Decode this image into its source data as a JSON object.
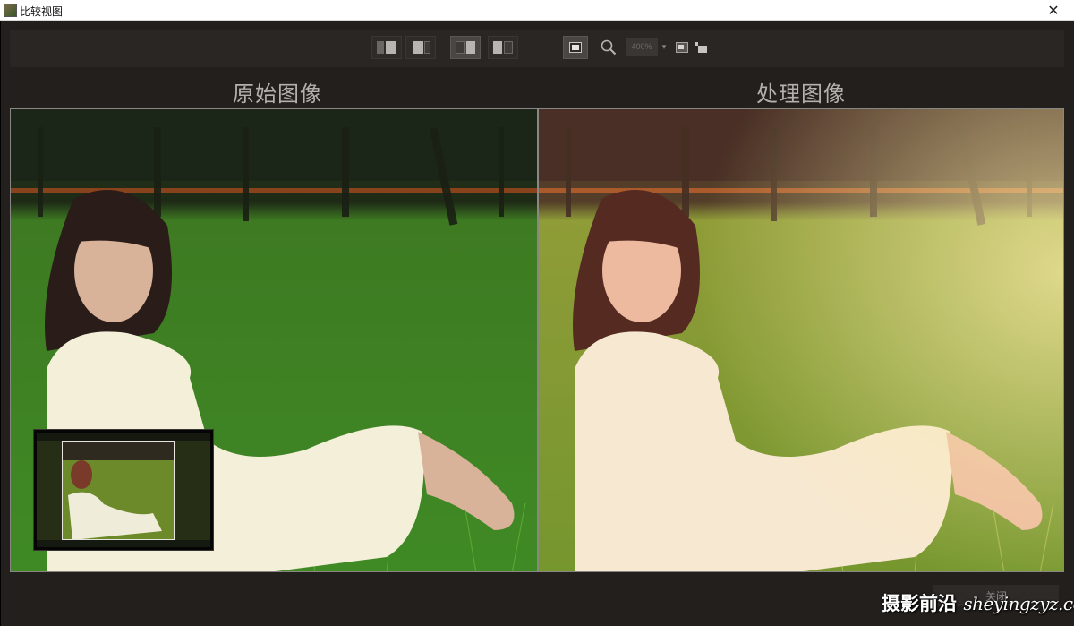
{
  "window": {
    "title": "比较视图",
    "close_glyph": "✕"
  },
  "toolbar": {
    "buttons": [
      {
        "name": "view-left-right-button",
        "icon": "split-left-right-icon"
      },
      {
        "name": "view-single-button",
        "icon": "single-view-icon"
      },
      {
        "name": "view-side-by-side-button",
        "icon": "side-by-side-icon",
        "active": true
      },
      {
        "name": "view-split-button",
        "icon": "split-view-icon"
      },
      {
        "name": "fit-screen-button",
        "icon": "fit-screen-icon",
        "active": true
      },
      {
        "name": "zoom-button",
        "icon": "magnifier-icon"
      },
      {
        "name": "navigator-toggle-button",
        "icon": "navigator-icon"
      },
      {
        "name": "sync-button",
        "icon": "sync-icon"
      }
    ],
    "zoom_value": "400%",
    "dropdown_glyph": "▾"
  },
  "panes": {
    "left_title": "原始图像",
    "right_title": "处理图像"
  },
  "footer": {
    "close_label": "关闭",
    "watermark_cn": "摄影前沿",
    "watermark_url": "sheyingzyz.com"
  },
  "colors": {
    "background": "#231f1d",
    "heading": "#b4b0ae",
    "grass": "#4a9a2e",
    "grass_processed": "#b9c84a",
    "dress": "#f4f0dc",
    "hair": "#2a1c18"
  }
}
